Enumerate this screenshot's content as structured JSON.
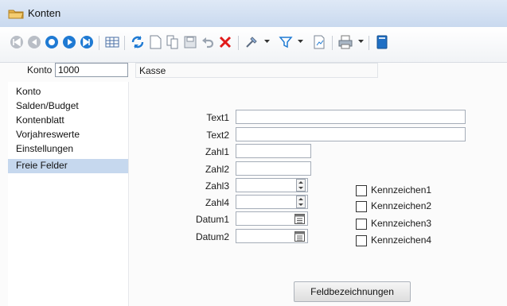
{
  "window": {
    "title": "Konten"
  },
  "toolbar": {
    "icons": [
      "first-record-icon",
      "previous-record-icon",
      "next-record-icon",
      "play-next-icon",
      "last-record-icon",
      "table-view-icon",
      "refresh-icon",
      "new-icon",
      "copy-icon",
      "save-icon",
      "undo-icon",
      "delete-icon",
      "tools-icon",
      "filter-icon",
      "report-icon",
      "print-icon",
      "book-icon"
    ]
  },
  "konto": {
    "label": "Konto",
    "value": "1000",
    "name": "Kasse"
  },
  "sidebar": {
    "items": [
      {
        "label": "Konto"
      },
      {
        "label": "Salden/Budget"
      },
      {
        "label": "Kontenblatt"
      },
      {
        "label": "Vorjahreswerte"
      },
      {
        "label": "Einstellungen"
      },
      {
        "label": "Freie Felder",
        "selected": true
      }
    ]
  },
  "form": {
    "fields": [
      {
        "label": "Text1",
        "value": ""
      },
      {
        "label": "Text2",
        "value": ""
      },
      {
        "label": "Zahl1",
        "value": ""
      },
      {
        "label": "Zahl2",
        "value": ""
      },
      {
        "label": "Zahl3",
        "value": ""
      },
      {
        "label": "Zahl4",
        "value": ""
      },
      {
        "label": "Datum1",
        "value": ""
      },
      {
        "label": "Datum2",
        "value": ""
      }
    ],
    "checkboxes": [
      {
        "label": "Kennzeichen1",
        "checked": false
      },
      {
        "label": "Kennzeichen2",
        "checked": false
      },
      {
        "label": "Kennzeichen3",
        "checked": false
      },
      {
        "label": "Kennzeichen4",
        "checked": false
      }
    ],
    "button_label": "Feldbezeichnungen"
  },
  "colors": {
    "selected_item": "#c6d8ee",
    "nav_blue": "#1f7ad3",
    "delete_red": "#e11a1a"
  }
}
